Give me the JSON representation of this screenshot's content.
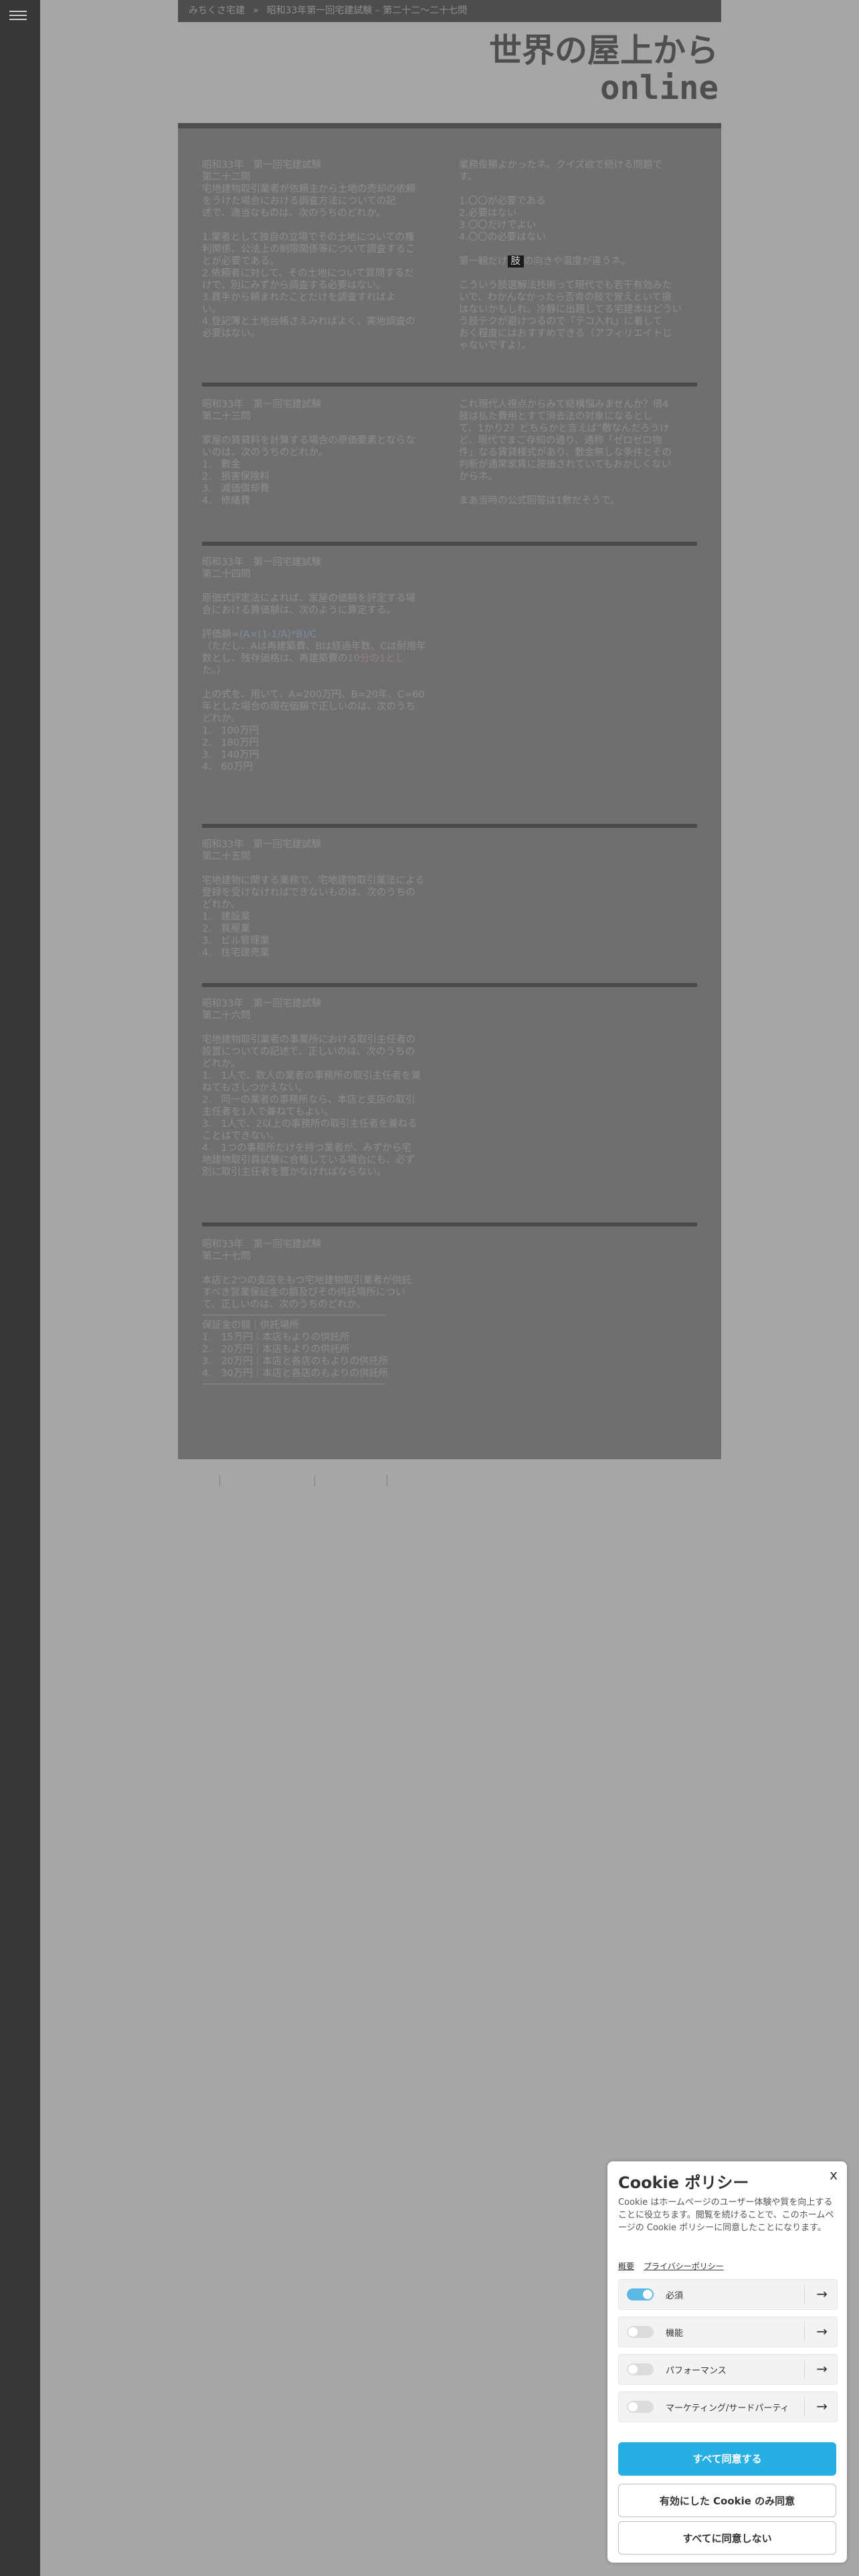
{
  "breadcrumb": {
    "home": "みちくさ宅建",
    "separator": "»",
    "current": "昭和33年第一回宅建試験 – 第二十二〜二十七問"
  },
  "site_title": {
    "line1": "世界の屋上から",
    "line2": "online"
  },
  "q22": {
    "lines": [
      "昭和33年　第一回宅建試験",
      "第二十二問",
      "宅地建物取引業者が依頼主から土地の売却の依頼",
      "をうけた場合における調査方法についての記",
      "述で、適当なものは、次のうちのどれか。"
    ],
    "options": [
      "1.業者として独自の立場でその土地についての権",
      "利関係、公法上の制限関係等について調査するこ",
      "とが必要である。",
      "2.依頼者に対して、その土地について質問するだ",
      "けで、別にみずから調査する必要はない。",
      "3.買手から頼まれたことだけを調査すればよ",
      "い。",
      "4.登記簿と土地台帳さえみればよく、実地調査の",
      "必要はない。"
    ],
    "comment": [
      "業務俊勝よかったネ。クイズ欲で続ける問題で",
      "す。"
    ],
    "quiz": [
      "1.〇〇が必要である",
      "2.必要はない",
      "3.〇〇だけでよい",
      "4.〇〇の必要はない"
    ],
    "note_pre": "第一観だけ",
    "note_box": "肢",
    "note_post": "の向きや温度が違うネ。",
    "note2": [
      "こういう肢選解法技術って現代でも若干有効みた",
      "いで、わかんなかったら否肯の肢で覚えといて損",
      "はないかもしれ。冷静に出題してる宅建本はどうい",
      "う肢テクが避けつるので「テコ入れ」に着して",
      "おく程度にはおすすめできる（アフィリエイトじ",
      "ゃないですよ）。"
    ]
  },
  "q23": {
    "lines": [
      "昭和33年　第一回宅建試験",
      "第二十三問",
      "",
      "家屋の賃貸料を計算する場合の原価要素とならな",
      "いのは、次のうちのどれか。"
    ],
    "options": [
      "1.　敷金",
      "2.　損害保険料",
      "3.　減価償却費",
      "4.　修繕費"
    ],
    "comment": [
      "これ現代人視点からみて結構悩みませんか？借4",
      "肢は払た費用とすて消去法の対象になるとし",
      "て、1かり2？どちらかと言えば”敷なんだろうけ",
      "ど、現代でまご存知の通り、通称「ゼロゼロ物",
      "件」なる賃貸様式があり、敷金無しな条件とその",
      "判断が通常家賃に按価されていてもおかしくない",
      "からネ。"
    ],
    "comment2": "まあ当時の公式回答は1敷だそうで。"
  },
  "q24": {
    "lines": [
      "昭和33年　第一回宅建試験",
      "第二十四問",
      "",
      "原価式評定法によれば、家屋の価額を評定する場",
      "合における算価額は、次のように算定する。",
      ""
    ],
    "formula_label": "評価額=",
    "formula": "(A×(1-1/A)*B)/C",
    "explain": [
      "（ただし、Aは再建築費、Bは経過年数、Cは耐用年",
      "数とし、残存価格は、再建築費の",
      "10分の1とし",
      "た。）"
    ],
    "ask": [
      "上の式を、用いて、A=200万円、B=20年、C=60",
      "年とした場合の現在価額で正しいのは、次のうち",
      "どれか。"
    ],
    "options": [
      "1.　100万円",
      "2.　180万円",
      "3.　140万円",
      "4.　60万円"
    ]
  },
  "q25": {
    "lines": [
      "昭和33年　第一回宅建試験",
      "第二十五問",
      "",
      "宅地建物に関する業務で、宅地建物取引業法による",
      "登録を受けなければできないものは、次のうちの",
      "どれか。"
    ],
    "options": [
      "1.　建設業",
      "2.　質屋業",
      "3.　ビル管理業",
      "4.　住宅建売業"
    ]
  },
  "q26": {
    "lines": [
      "昭和33年　第一回宅建試験",
      "第二十六問",
      "",
      "宅地建物取引業者の事業所における取引主任者の",
      "設置についての記述で、正しいのは、次のうちの",
      "どれか。"
    ],
    "options": [
      "1.　1人で、数人の業者の事務所の取引主任者を兼",
      "ねてもさしつかえない。",
      "2.　同一の業者の事務所なら、本店と支店の取引",
      "主任者を1人で兼ねてもよい。",
      "3.　1人で、2以上の事務所の取引主任者を兼ねる",
      "ことはできない。",
      "4.　1つの事務所だけを持つ業者が、みずから宅",
      "地建物取引員試験に合格している場合にも、必ず",
      "別に取引主任者を置かなければならない。"
    ]
  },
  "q27": {
    "lines": [
      "昭和33年　第一回宅建試験",
      "第二十七問",
      "",
      "本店と2つの支店をもつ宅地建物取引業者が供託",
      "すべき営業保証金の額及びその供託場所につい",
      "て、正しいのは、次のうちのどれか。"
    ],
    "table_header": "保証金の額｜供託場所",
    "options": [
      "1.　15万円｜本店もよりの供託所",
      "2.　20万円｜本店もよりの供託所",
      "3.　20万円｜本店と各店のもよりの供託所",
      "4.　30万円｜本店と各店のもよりの供託所"
    ]
  },
  "cookie": {
    "close": "x",
    "title": "Cookie ポリシー",
    "description": "Cookie はホームページのユーザー体験や質を向上することに役立ちます。閲覧を続けることで、このホームページの Cookie ポリシーに同意したことになります。",
    "link_overview": "概要",
    "link_privacy": "プライバシーポリシー",
    "categories": [
      {
        "label": "必須",
        "enabled": true
      },
      {
        "label": "機能",
        "enabled": false
      },
      {
        "label": "パフォーマンス",
        "enabled": false
      },
      {
        "label": "マーケティング/サードパーティ",
        "enabled": false
      }
    ],
    "accept_all": "すべて同意する",
    "accept_enabled": "有効にした Cookie のみ同意",
    "reject_all": "すべてに同意しない",
    "colors": {
      "primary": "#27aee3",
      "toggle_on": "#5bb8e3"
    }
  }
}
